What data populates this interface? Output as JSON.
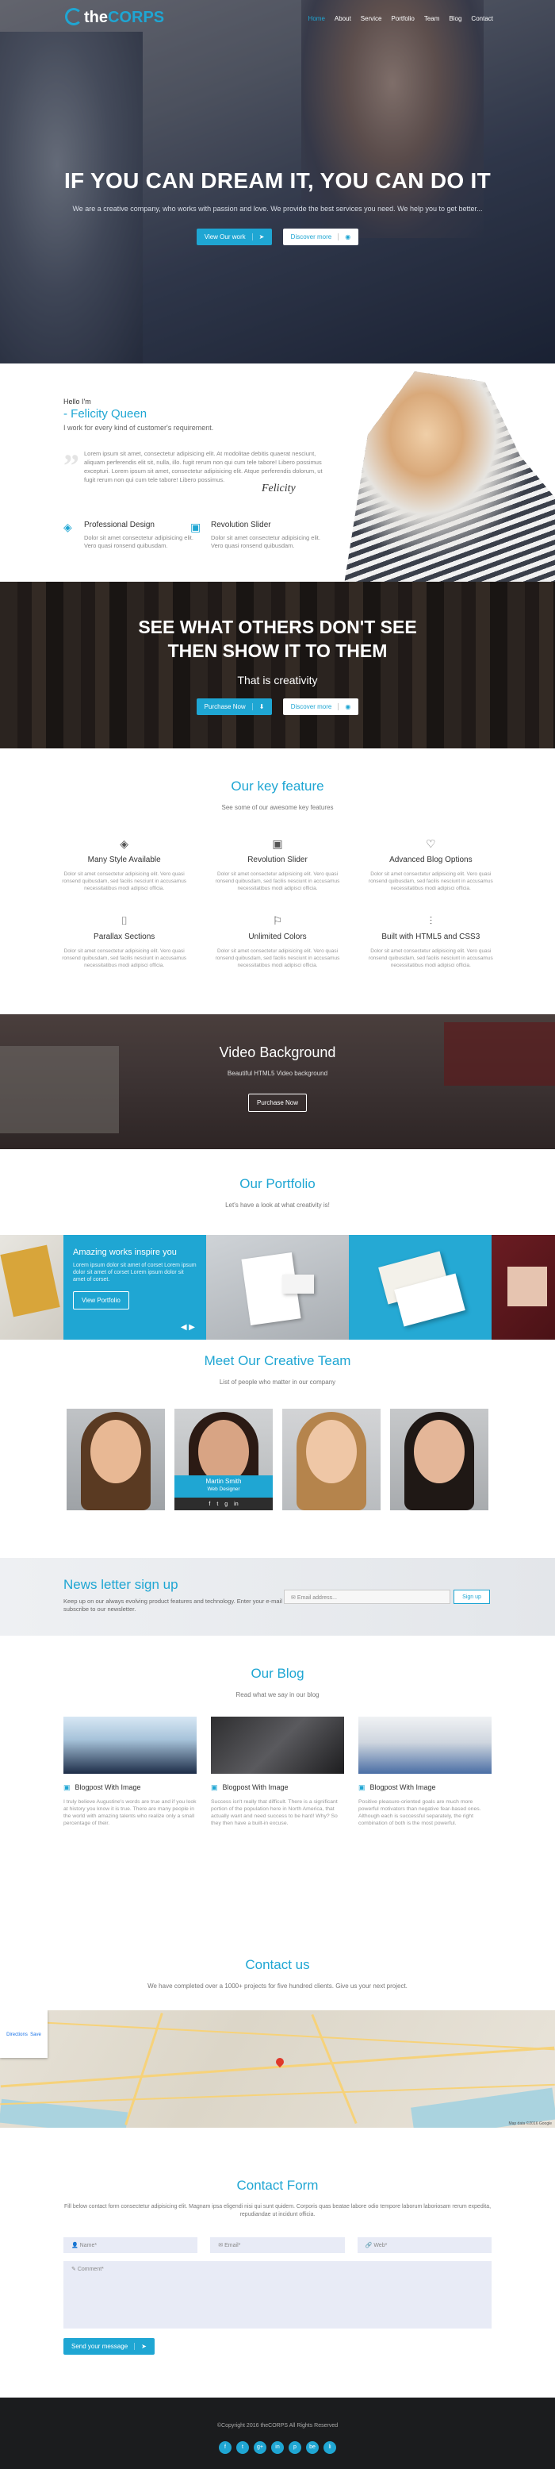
{
  "nav": {
    "logo_prefix": "the",
    "logo_brand": "CORPS",
    "items": [
      "Home",
      "About",
      "Service",
      "Portfolio",
      "Team",
      "Blog",
      "Contact"
    ]
  },
  "hero": {
    "title": "IF YOU CAN DREAM IT, YOU CAN DO IT",
    "subtitle": "We are a creative company, who works with passion and love. We provide the best services you need. We help you to get better...",
    "btn_primary": "View Our work",
    "btn_secondary": "Discover more"
  },
  "about": {
    "hello": "Hello I'm",
    "name": "- Felicity Queen",
    "work": "I work for every kind of customer's requirement.",
    "para": "Lorem ipsum sit amet, consectetur adipisicing elit. At modolitae debitis quaerat nesciunt, aliquam perferendis elit sit, nulla, illo. fugit rerum non qui cum tele tabore! Libero possimus excepturi. Lorem ipsum sit amet, consectetur adipisicing elit. Atque perferendis dolorum, ut fugit rerum non qui cum tele tabore! Libero possimus.",
    "signature": "Felicity",
    "features": [
      {
        "title": "Professional Design",
        "desc": "Dolor sit amet consectetur adipisicing elit. Vero quasi ronsend quibusdam."
      },
      {
        "title": "Revolution Slider",
        "desc": "Dolor sit amet consectetur adipisicing elit. Vero quasi ronsend quibusdam."
      }
    ]
  },
  "see": {
    "title_line1": "SEE WHAT OTHERS DON'T SEE",
    "title_line2": "THEN SHOW IT TO THEM",
    "subtitle": "That is creativity",
    "btn_primary": "Purchase Now",
    "btn_secondary": "Discover more"
  },
  "features": {
    "title": "Our key feature",
    "subtitle": "See some of our awesome key features",
    "items": [
      {
        "icon": "layers-icon",
        "title": "Many Style Available",
        "desc": "Dolor sit amet consectetur adipisicing elit. Vero quasi ronsend quibusdam, sed facilis nesciunt in accusamus necessitatibus modi adipisci officia."
      },
      {
        "icon": "image-icon",
        "title": "Revolution Slider",
        "desc": "Dolor sit amet consectetur adipisicing elit. Vero quasi ronsend quibusdam, sed facilis nesciunt in accusamus necessitatibus modi adipisci officia."
      },
      {
        "icon": "heart-icon",
        "title": "Advanced Blog Options",
        "desc": "Dolor sit amet consectetur adipisicing elit. Vero quasi ronsend quibusdam, sed facilis nesciunt in accusamus necessitatibus modi adipisci officia."
      },
      {
        "icon": "mouse-icon",
        "title": "Parallax Sections",
        "desc": "Dolor sit amet consectetur adipisicing elit. Vero quasi ronsend quibusdam, sed facilis nesciunt in accusamus necessitatibus modi adipisci officia."
      },
      {
        "icon": "flag-icon",
        "title": "Unlimited Colors",
        "desc": "Dolor sit amet consectetur adipisicing elit. Vero quasi ronsend quibusdam, sed facilis nesciunt in accusamus necessitatibus modi adipisci officia."
      },
      {
        "icon": "sliders-icon",
        "title": "Built with HTML5 and CSS3",
        "desc": "Dolor sit amet consectetur adipisicing elit. Vero quasi ronsend quibusdam, sed facilis nesciunt in accusamus necessitatibus modi adipisci officia."
      }
    ]
  },
  "video": {
    "title": "Video Background",
    "subtitle": "Beautiful HTML5 Video background",
    "btn": "Purchase Now"
  },
  "portfolio": {
    "title": "Our Portfolio",
    "subtitle": "Let's have a look at what creativity is!",
    "featured_title": "Amazing works inspire you",
    "featured_desc": "Lorem ipsum dolor sit amet of corset Lorem ipsum dolor sit amet of corset Lorem ipsum dolor sit amet of corset.",
    "featured_btn": "View Portfolio"
  },
  "team": {
    "title": "Meet Our Creative Team",
    "subtitle": "List of people who matter in our company",
    "highlight_name": "Martin Smith",
    "highlight_role": "Web Designer"
  },
  "newsletter": {
    "title": "News letter sign up",
    "desc": "Keep up on our always evolving product features and technology. Enter your e-mail and subscribe to our newsletter.",
    "placeholder": "Email address...",
    "btn": "Sign up"
  },
  "blog": {
    "title": "Our Blog",
    "subtitle": "Read what we say in our blog",
    "posts": [
      {
        "title": "Blogpost With Image",
        "desc": "I truly believe Augustine's words are true and if you look at history you know it is true. There are many people in the world with amazing talents who realize only a small percentage of their."
      },
      {
        "title": "Blogpost With Image",
        "desc": "Success isn't really that difficult. There is a significant portion of the population here in North America, that actually want and need success to be hard! Why? So they then have a built-in excuse."
      },
      {
        "title": "Blogpost With Image",
        "desc": "Positive pleasure-oriented goals are much more powerful motivators than negative fear-based ones. Although each is successful separately, the right combination of both is the most powerful."
      }
    ]
  },
  "contact": {
    "title": "Contact us",
    "subtitle": "We have completed over a 1000+ projects for five hundred clients. Give us your next project.",
    "map_directions": "Directions",
    "map_save": "Save",
    "map_credit": "Map data ©2016 Google"
  },
  "form": {
    "title": "Contact Form",
    "desc": "Fill below contact form consectetur adipisicing elit. Magnam ipsa eligendi nisi qui sunt quidem. Corporis quas beatae labore odio tempore laborum laboriosam rerum expedita, repudiandae ut incidunt officia.",
    "name": "Name*",
    "email": "Email*",
    "web": "Web*",
    "comment": "Comment*",
    "send": "Send your message"
  },
  "footer": {
    "copyright": "©Copyright 2016 theCORPS All Rights Reserved",
    "social": [
      "f",
      "t",
      "g+",
      "in",
      "p",
      "be",
      "li"
    ]
  },
  "colors": {
    "accent": "#1fa6d3",
    "dark": "#1b1c1e"
  }
}
